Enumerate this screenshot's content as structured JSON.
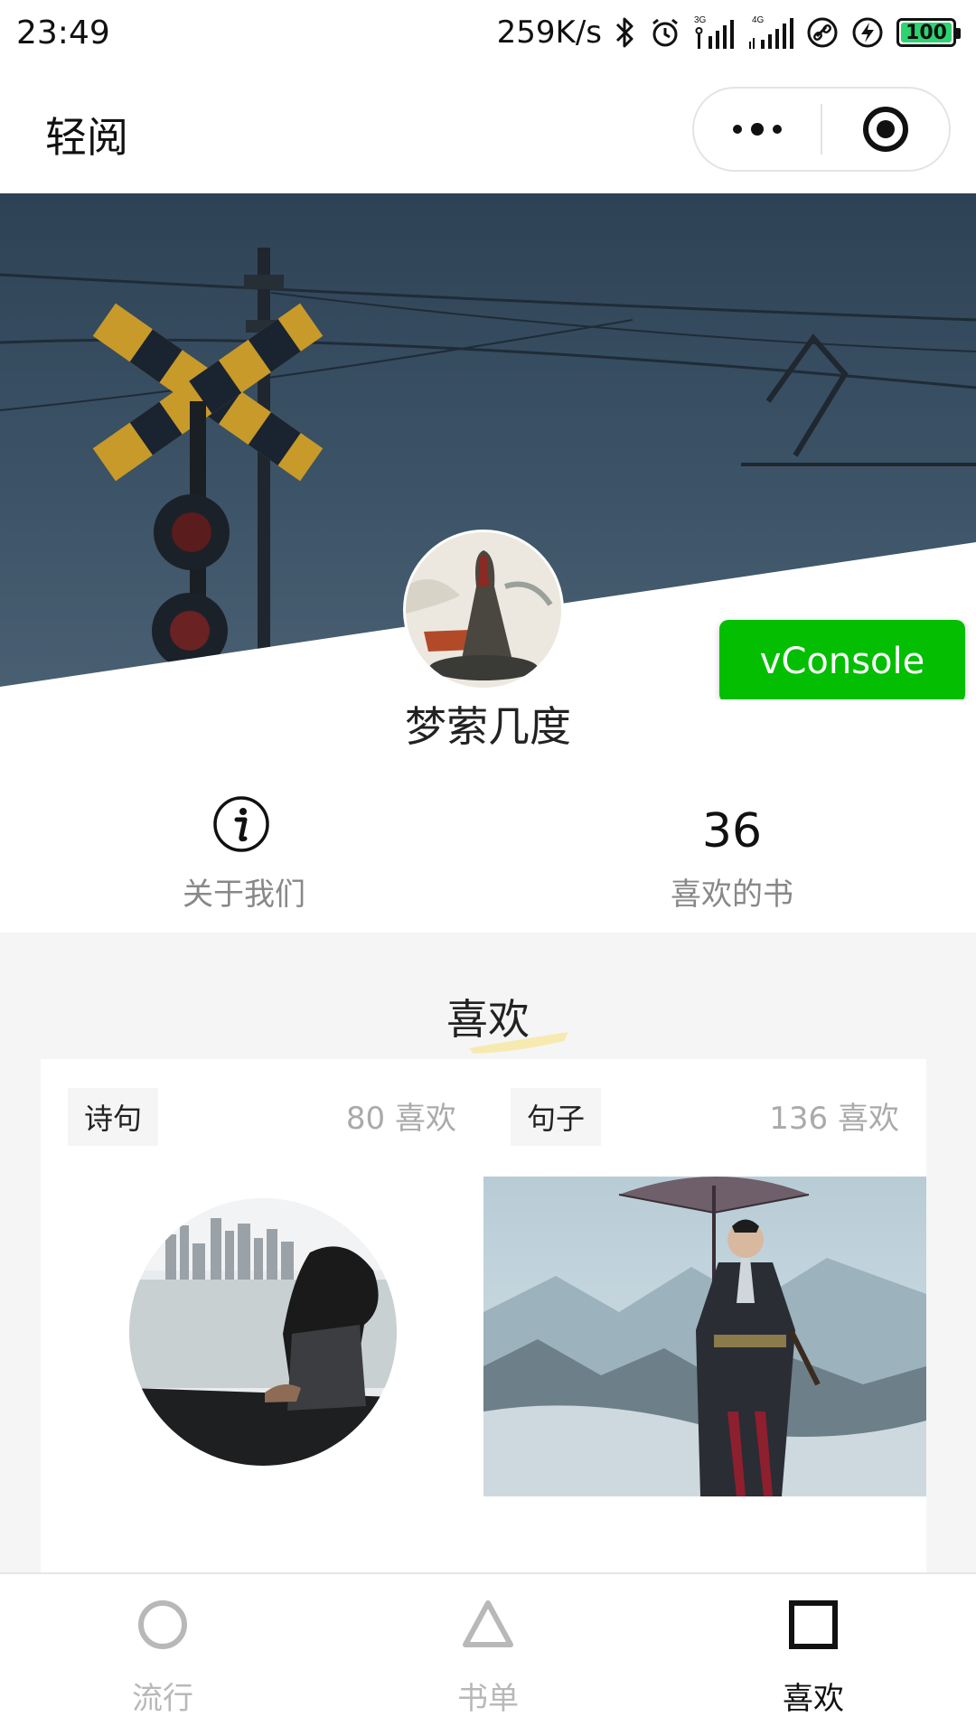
{
  "status_bar": {
    "time": "23:49",
    "speed": "259K/s",
    "net_3g": "3G",
    "net_4g": "4G",
    "battery": "100",
    "icons": [
      "bluetooth-icon",
      "alarm-icon",
      "signal-3g-icon",
      "signal-4g-icon",
      "link-icon",
      "charging-icon",
      "battery-icon"
    ]
  },
  "nav": {
    "title": "轻阅",
    "more_icon": "more-dots-icon",
    "close_icon": "target-circle-icon"
  },
  "banner": {
    "vconsole_label": "vConsole"
  },
  "profile": {
    "username": "梦萦几度"
  },
  "stats": {
    "about_label": "关于我们",
    "about_icon": "info-icon",
    "liked_books_count": "36",
    "liked_books_label": "喜欢的书"
  },
  "likes": {
    "section_title": "喜欢",
    "cards": [
      {
        "tag": "诗句",
        "likes": "80 喜欢"
      },
      {
        "tag": "句子",
        "likes": "136 喜欢"
      }
    ]
  },
  "tab_bar": {
    "tabs": [
      {
        "label": "流行",
        "icon": "circle-icon",
        "active": false
      },
      {
        "label": "书单",
        "icon": "triangle-icon",
        "active": false
      },
      {
        "label": "喜欢",
        "icon": "square-icon",
        "active": true
      }
    ]
  },
  "colors": {
    "vconsole_green": "#04be02",
    "active_tab": "#111111",
    "inactive_tab": "#b8b8b8",
    "section_bg": "#f5f5f5"
  }
}
